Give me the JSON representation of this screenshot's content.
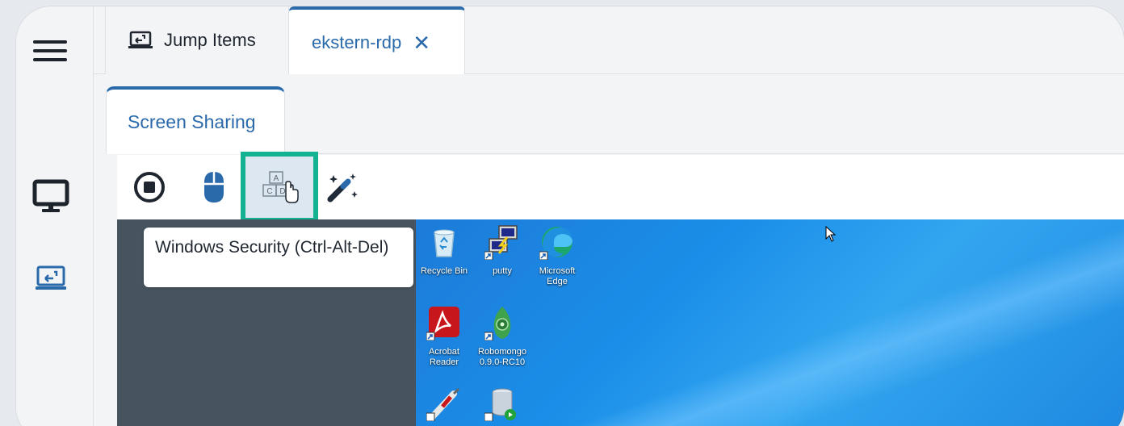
{
  "tabs": {
    "jump_items": "Jump Items",
    "session": "ekstern-rdp",
    "close": "✕"
  },
  "subtab": {
    "label": "Screen Sharing"
  },
  "toolbar": {
    "tooltip": "Windows Security (Ctrl-Alt-Del)",
    "keys_top": "A",
    "keys_left": "C",
    "keys_right": "D"
  },
  "desktop_icons": {
    "recycle": "Recycle Bin",
    "putty": "putty",
    "edge": "Microsoft Edge",
    "acrobat": "Acrobat Reader",
    "robomongo": "Robomongo 0.9.0-RC10"
  },
  "colors": {
    "accent": "#2a6aab",
    "highlight": "#12b293",
    "remote_bg": "#47545f"
  }
}
